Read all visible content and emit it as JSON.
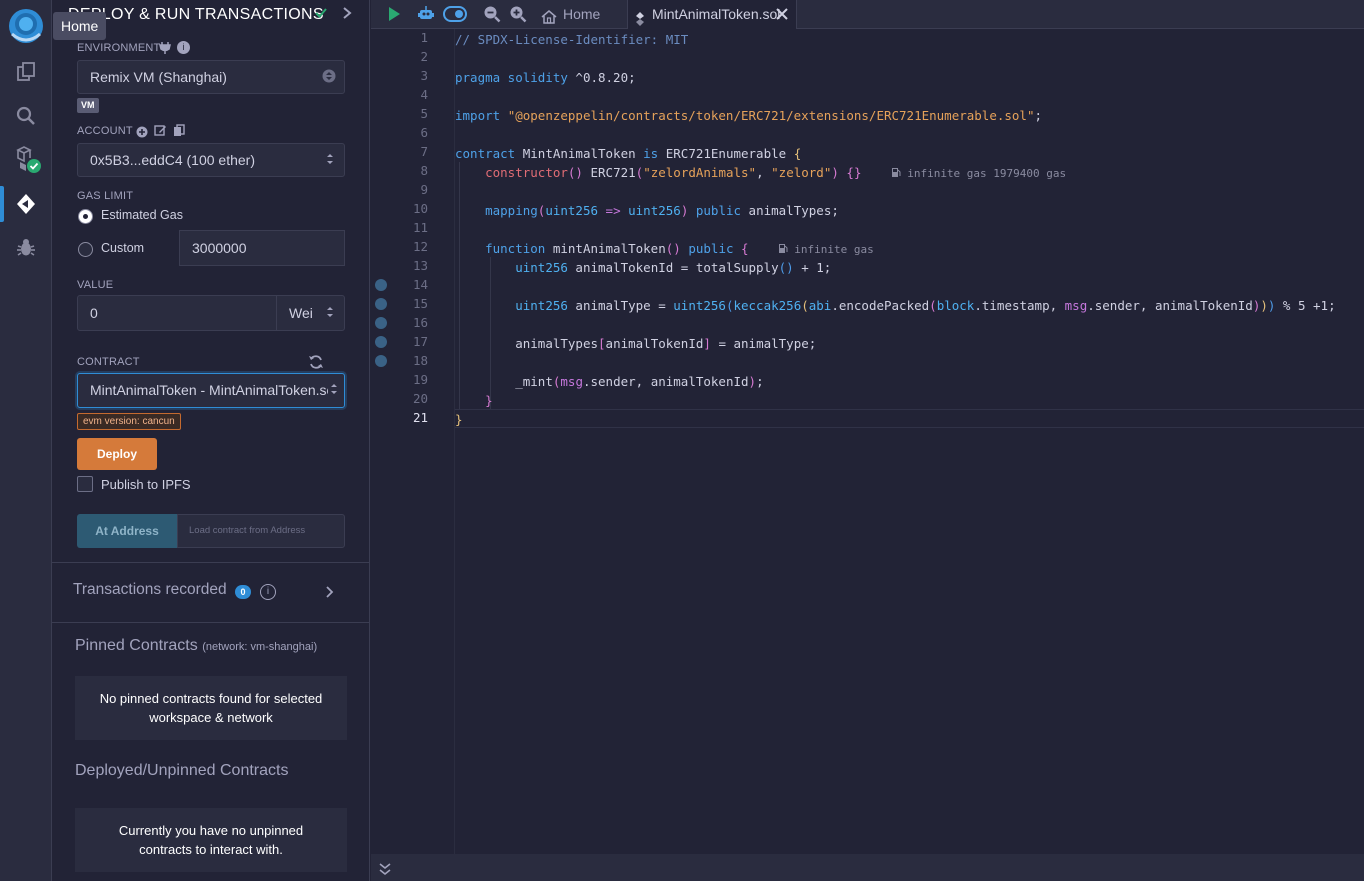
{
  "app": {
    "tooltip": "Home"
  },
  "panel": {
    "title": "DEPLOY & RUN TRANSACTIONS",
    "environment_label": "ENVIRONMENT",
    "environment_value": "Remix VM (Shanghai)",
    "vm_badge": "VM",
    "account_label": "ACCOUNT",
    "account_value": "0x5B3...eddC4 (100 ether)",
    "gas_limit_label": "GAS LIMIT",
    "estimated_gas_label": "Estimated Gas",
    "custom_label": "Custom",
    "custom_gas_value": "3000000",
    "value_label": "VALUE",
    "value_amount": "0",
    "value_unit": "Wei",
    "contract_label": "CONTRACT",
    "contract_value": "MintAnimalToken - MintAnimalToken.sol",
    "evm_badge": "evm version: cancun",
    "deploy_label": "Deploy",
    "publish_label": "Publish to IPFS",
    "at_address_label": "At Address",
    "at_address_placeholder": "Load contract from Address",
    "transactions_recorded_label": "Transactions recorded",
    "transactions_count": "0",
    "pinned_title": "Pinned Contracts",
    "pinned_network": "(network: vm-shanghai)",
    "pinned_empty": "No pinned contracts found for selected workspace & network",
    "deployed_title": "Deployed/Unpinned Contracts",
    "deployed_empty": "Currently you have no unpinned contracts to interact with."
  },
  "editor": {
    "home_tab": "Home",
    "active_tab": "MintAnimalToken.sol",
    "line_numbers": [
      "1",
      "2",
      "3",
      "4",
      "5",
      "6",
      "7",
      "8",
      "9",
      "10",
      "11",
      "12",
      "13",
      "14",
      "15",
      "16",
      "17",
      "18",
      "19",
      "20",
      "21"
    ],
    "current_line": "21",
    "hints": {
      "constructor": "infinite gas 1979400 gas",
      "mint": "infinite gas"
    },
    "code": {
      "l1": "// SPDX-License-Identifier: MIT",
      "l3_kw": "pragma solidity",
      "l3_rest": " ^0.8.20;",
      "l5_kw": "import",
      "l5_str": "\"@openzeppelin/contracts/token/ERC721/extensions/ERC721Enumerable.sol\"",
      "l5_end": ";",
      "l7_kw": "contract",
      "l7_name": " MintAnimalToken ",
      "l7_is": "is",
      "l7_base": " ERC721Enumerable ",
      "l7_brace": "{",
      "l8_kw": "constructor",
      "l8_paren": "()",
      "l8_call": " ERC721",
      "l8_args_open": "(",
      "l8_s1": "\"zelordAnimals\"",
      "l8_comma": ", ",
      "l8_s2": "\"zelord\"",
      "l8_args_close": ")",
      "l8_body": " {}",
      "l10_kw": "mapping",
      "l10_open": "(",
      "l10_t1": "uint256",
      "l10_arrow": " => ",
      "l10_t2": "uint256",
      "l10_close": ")",
      "l10_pub": " public",
      "l10_name": " animalTypes;",
      "l12_kw": "function",
      "l12_name": " mintAnimalToken",
      "l12_paren": "()",
      "l12_pub": " public",
      "l12_brace": " {",
      "l13_ty": "uint256",
      "l13_rest": " animalTokenId = totalSupply",
      "l13_paren": "()",
      "l13_end": " + 1;",
      "l15_ty": "uint256",
      "l15_rest1": " animalType = ",
      "l15_ty2": "uint256",
      "l15_p1": "(",
      "l15_kec": "keccak256",
      "l15_p2": "(",
      "l15_abi": "abi",
      "l15_enc": ".encodePacked",
      "l15_p3": "(",
      "l15_block": "block",
      "l15_ts": ".timestamp, ",
      "l15_msg": "msg",
      "l15_sender": ".sender, animalTokenId",
      "l15_close3": ")",
      "l15_close2": ")",
      "l15_close1": ")",
      "l15_end": " % 5 +1;",
      "l17_a": "animalTypes",
      "l17_b1": "[",
      "l17_c": "animalTokenId",
      "l17_b2": "]",
      "l17_d": " = animalType;",
      "l19_a": "_mint",
      "l19_p1": "(",
      "l19_msg": "msg",
      "l19_rest": ".sender, animalTokenId",
      "l19_p2": ")",
      "l19_end": ";",
      "l20": "}",
      "l21": "}"
    }
  }
}
